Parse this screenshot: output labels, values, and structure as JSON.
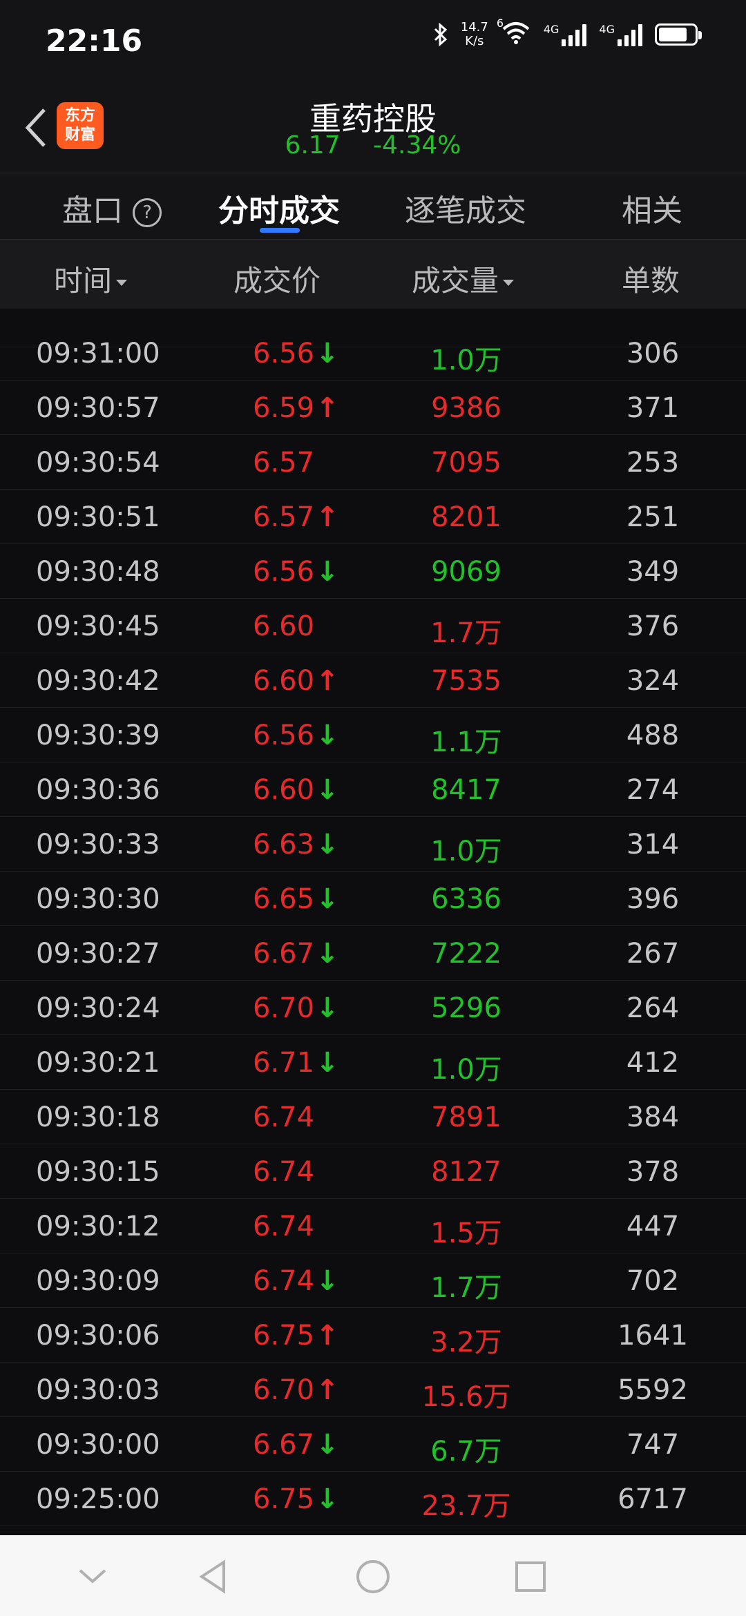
{
  "status": {
    "time": "22:16",
    "speed_top": "14.7",
    "speed_bottom": "K/s",
    "wifi_badge": "6",
    "sim1": "4G",
    "sim2": "4G",
    "battery_level": 0.8
  },
  "header": {
    "title": "重药控股",
    "price": "6.17",
    "change": "-4.34%",
    "logo_line1": "东方",
    "logo_line2": "财富"
  },
  "tabs": [
    {
      "label": "盘口",
      "help": "?"
    },
    {
      "label": "分时成交"
    },
    {
      "label": "逐笔成交"
    },
    {
      "label": "相关"
    }
  ],
  "columns": {
    "time": "时间",
    "price": "成交价",
    "volume": "成交量",
    "count": "单数"
  },
  "colors": {
    "up": "#e82a2a",
    "down": "#22c02a",
    "accent": "#2f7bff"
  },
  "rows": [
    {
      "time": "09:31:00",
      "price": "6.56",
      "dir": "down",
      "volume": "1.0万",
      "vol_color": "green",
      "count": "306"
    },
    {
      "time": "09:30:57",
      "price": "6.59",
      "dir": "up",
      "volume": "9386",
      "vol_color": "red",
      "count": "371"
    },
    {
      "time": "09:30:54",
      "price": "6.57",
      "dir": "",
      "volume": "7095",
      "vol_color": "red",
      "count": "253"
    },
    {
      "time": "09:30:51",
      "price": "6.57",
      "dir": "up",
      "volume": "8201",
      "vol_color": "red",
      "count": "251"
    },
    {
      "time": "09:30:48",
      "price": "6.56",
      "dir": "down",
      "volume": "9069",
      "vol_color": "green",
      "count": "349"
    },
    {
      "time": "09:30:45",
      "price": "6.60",
      "dir": "",
      "volume": "1.7万",
      "vol_color": "red",
      "count": "376"
    },
    {
      "time": "09:30:42",
      "price": "6.60",
      "dir": "up",
      "volume": "7535",
      "vol_color": "red",
      "count": "324"
    },
    {
      "time": "09:30:39",
      "price": "6.56",
      "dir": "down",
      "volume": "1.1万",
      "vol_color": "green",
      "count": "488"
    },
    {
      "time": "09:30:36",
      "price": "6.60",
      "dir": "down",
      "volume": "8417",
      "vol_color": "green",
      "count": "274"
    },
    {
      "time": "09:30:33",
      "price": "6.63",
      "dir": "down",
      "volume": "1.0万",
      "vol_color": "green",
      "count": "314"
    },
    {
      "time": "09:30:30",
      "price": "6.65",
      "dir": "down",
      "volume": "6336",
      "vol_color": "green",
      "count": "396"
    },
    {
      "time": "09:30:27",
      "price": "6.67",
      "dir": "down",
      "volume": "7222",
      "vol_color": "green",
      "count": "267"
    },
    {
      "time": "09:30:24",
      "price": "6.70",
      "dir": "down",
      "volume": "5296",
      "vol_color": "green",
      "count": "264"
    },
    {
      "time": "09:30:21",
      "price": "6.71",
      "dir": "down",
      "volume": "1.0万",
      "vol_color": "green",
      "count": "412"
    },
    {
      "time": "09:30:18",
      "price": "6.74",
      "dir": "",
      "volume": "7891",
      "vol_color": "red",
      "count": "384"
    },
    {
      "time": "09:30:15",
      "price": "6.74",
      "dir": "",
      "volume": "8127",
      "vol_color": "red",
      "count": "378"
    },
    {
      "time": "09:30:12",
      "price": "6.74",
      "dir": "",
      "volume": "1.5万",
      "vol_color": "red",
      "count": "447"
    },
    {
      "time": "09:30:09",
      "price": "6.74",
      "dir": "down",
      "volume": "1.7万",
      "vol_color": "green",
      "count": "702"
    },
    {
      "time": "09:30:06",
      "price": "6.75",
      "dir": "up",
      "volume": "3.2万",
      "vol_color": "red",
      "count": "1641"
    },
    {
      "time": "09:30:03",
      "price": "6.70",
      "dir": "up",
      "volume": "15.6万",
      "vol_color": "red",
      "count": "5592"
    },
    {
      "time": "09:30:00",
      "price": "6.67",
      "dir": "down",
      "volume": "6.7万",
      "vol_color": "green",
      "count": "747"
    },
    {
      "time": "09:25:00",
      "price": "6.75",
      "dir": "down",
      "volume": "23.7万",
      "vol_color": "red",
      "count": "6717"
    }
  ],
  "nav": {
    "icons": [
      "chevron-down-icon",
      "back-triangle-icon",
      "home-circle-icon",
      "recents-square-icon"
    ]
  }
}
